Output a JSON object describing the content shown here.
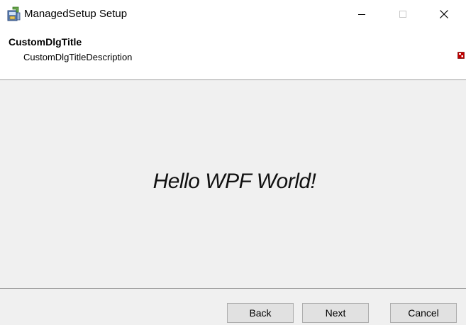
{
  "window": {
    "title": "ManagedSetup Setup",
    "app_icon": "installer-icon"
  },
  "caption_buttons": {
    "minimize_icon": "minimize-icon",
    "maximize_icon": "maximize-icon",
    "close_icon": "close-icon"
  },
  "banner": {
    "title": "CustomDlgTitle",
    "description": "CustomDlgTitleDescription",
    "banner_icon": "banner-image-icon"
  },
  "body": {
    "message": "Hello WPF World!"
  },
  "footer": {
    "back_label": "Back",
    "next_label": "Next",
    "cancel_label": "Cancel"
  },
  "colors": {
    "body_background": "#f0f0f0",
    "button_background": "#e1e1e1",
    "button_border": "#adadad",
    "banner_icon_red": "#c00000"
  }
}
